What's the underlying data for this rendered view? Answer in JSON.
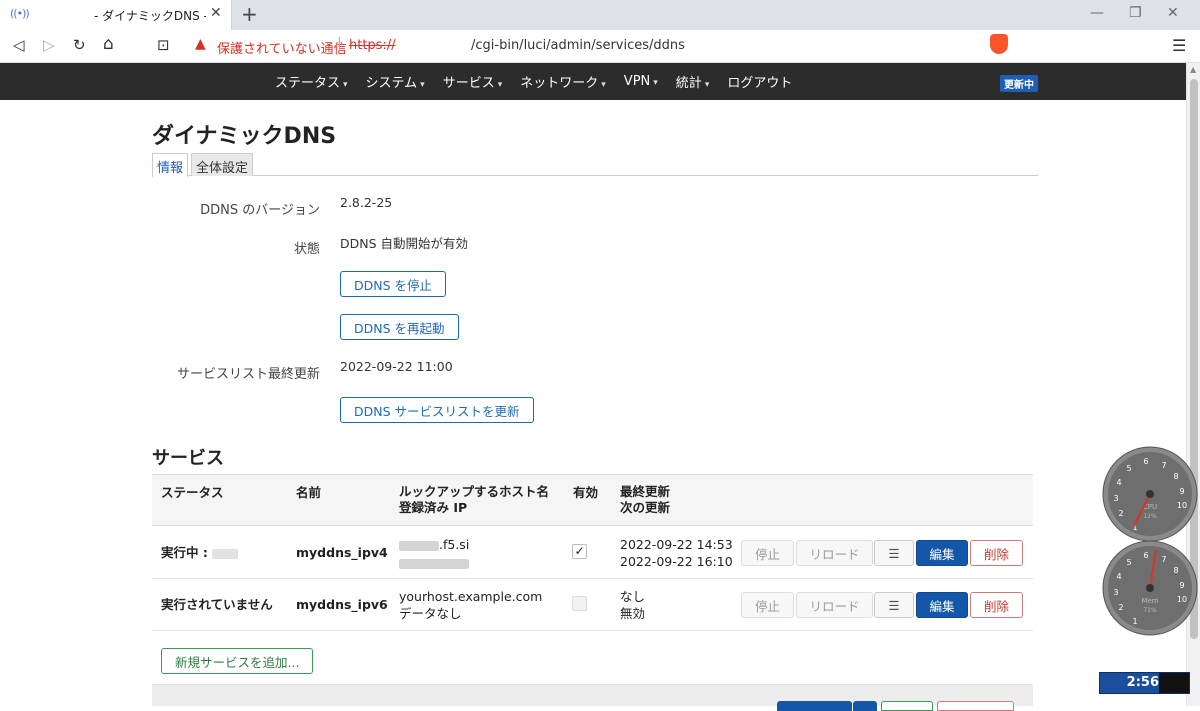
{
  "browser": {
    "tab_title": "- ダイナミックDNS - LuCI",
    "tab_favicon": "((•))",
    "tab_close": "✕",
    "new_tab": "+",
    "win_min": "—",
    "win_max": "❐",
    "win_close": "✕",
    "insecure_label": "保護されていない通信",
    "url_scheme": "https://",
    "url_path": "/cgi-bin/luci/admin/services/ddns",
    "back": "◁",
    "forward": "▷",
    "reload": "↻",
    "home": "⌂",
    "bookmark": "⊡",
    "menu": "☰",
    "warn": "▲",
    "url_sep": "|"
  },
  "nav": {
    "items": [
      "ステータス",
      "システム",
      "サービス",
      "ネットワーク",
      "VPN",
      "統計",
      "ログアウト"
    ],
    "caret": "▾",
    "update_badge": "更新中"
  },
  "page": {
    "title": "ダイナミックDNS",
    "tabs": [
      "情報",
      "全体設定"
    ]
  },
  "info": {
    "version_label": "DDNS のバージョン",
    "version_value": "2.8.2-25",
    "state_label": "状態",
    "state_value": "DDNS 自動開始が有効",
    "stop_btn": "DDNS を停止",
    "restart_btn": "DDNS を再起動",
    "list_label": "サービスリスト最終更新",
    "list_value": "2022-09-22 11:00",
    "update_list_btn": "DDNS サービスリストを更新"
  },
  "services": {
    "title": "サービス",
    "headers": {
      "status": "ステータス",
      "name": "名前",
      "host": "ルックアップするホスト名",
      "ip": "登録済み IP",
      "enabled": "有効",
      "last": "最終更新",
      "next": "次の更新"
    },
    "rows": [
      {
        "status": "実行中 :",
        "name": "myddns_ipv4",
        "host": ".f5.si",
        "ip": "",
        "enabled_mark": "✓",
        "last": "2022-09-22 14:53",
        "next": "2022-09-22 16:10"
      },
      {
        "status": "実行されていません",
        "name": "myddns_ipv6",
        "host": "yourhost.example.com",
        "ip": "データなし",
        "enabled_mark": "",
        "last": "なし",
        "next": "無効"
      }
    ],
    "row_buttons": {
      "stop": "停止",
      "reload": "リロード",
      "menu": "☰",
      "edit": "編集",
      "delete": "削除"
    },
    "add_btn": "新規サービスを追加..."
  },
  "gadgets": {
    "cpu_label": "CPU",
    "cpu_value": "12%",
    "mem_label": "Mem",
    "mem_value": "71%",
    "clock": "2:56",
    "dial_numbers": [
      "1",
      "2",
      "3",
      "4",
      "5",
      "6",
      "7",
      "8",
      "9",
      "10"
    ]
  },
  "colors": {
    "accent": "#1e6ab4",
    "edit": "#1457a8",
    "danger": "#c0392b",
    "success": "#2d7d42",
    "header": "#2c2c2c"
  }
}
